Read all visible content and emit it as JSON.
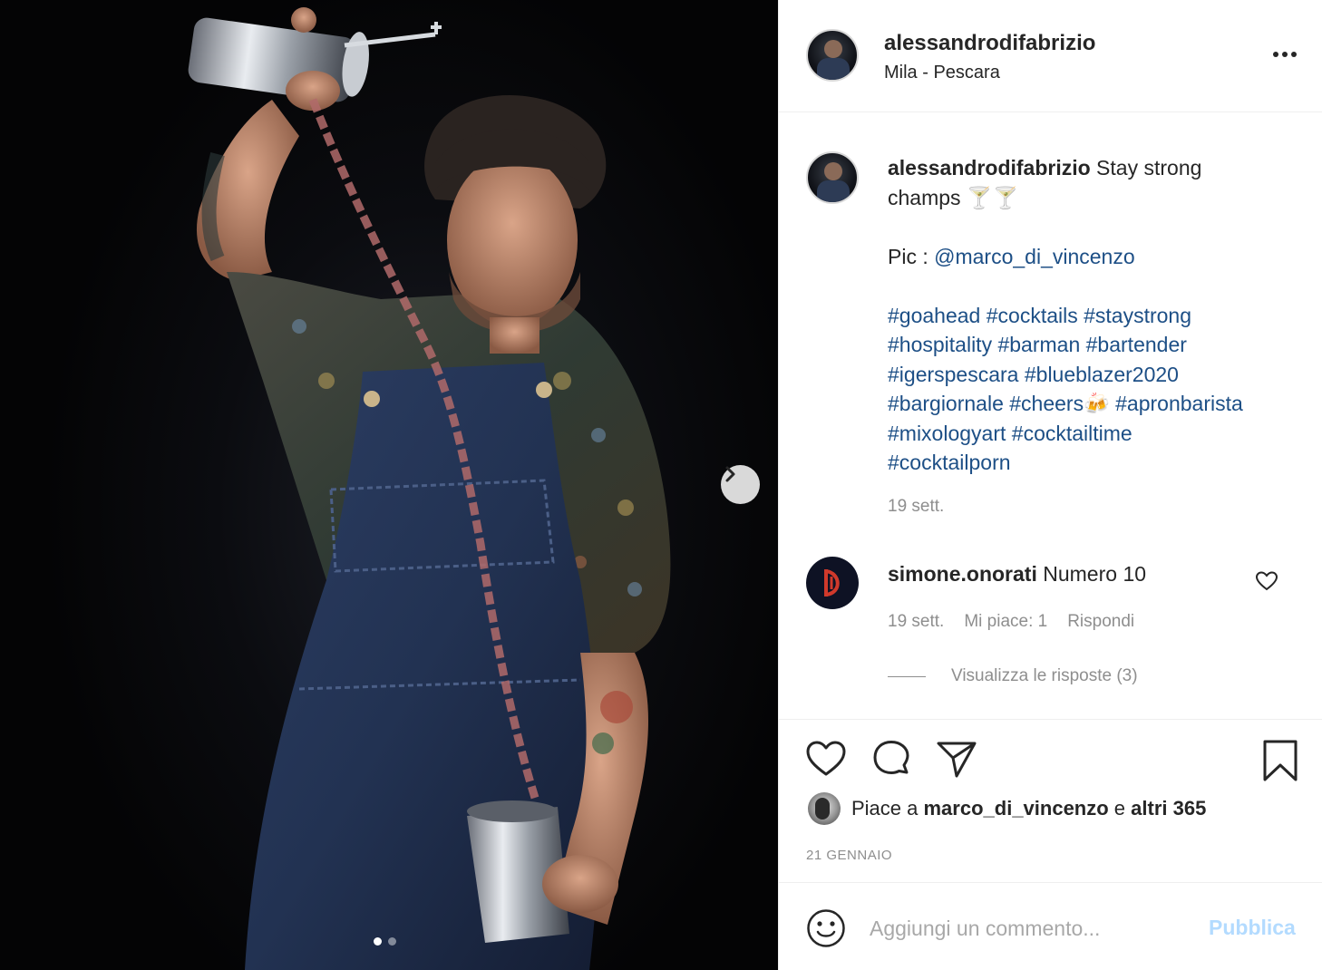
{
  "post": {
    "username": "alessandrodifabrizio",
    "location": "Mila - Pescara"
  },
  "caption": {
    "username": "alessandrodifabrizio",
    "text_line1": " Stay strong",
    "text_line2": "champs 🍸🍸",
    "credit_label": "Pic : ",
    "credit_mention": "@marco_di_vincenzo",
    "hashtags_row1": [
      "#goahead",
      "#cocktails",
      "#staystrong"
    ],
    "hashtags_row2": [
      "#hospitality",
      "#barman",
      "#bartender"
    ],
    "hashtags_row3": [
      "#igerspescara",
      "#blueblazer2020"
    ],
    "hashtags_row4a": "#bargiornale",
    "hashtags_row4b": "#cheers",
    "hashtags_row4_emoji": "🍻",
    "hashtags_row4c": "#apronbarista",
    "hashtags_row5": [
      "#mixologyart",
      "#cocktailtime"
    ],
    "hashtags_row6": [
      "#cocktailporn"
    ],
    "time": "19 sett."
  },
  "comment": {
    "username": "simone.onorati",
    "text": " Numero 10",
    "time": "19 sett.",
    "likes": "Mi piace: 1",
    "reply": "Rispondi",
    "view_replies": "Visualizza le risposte (3)"
  },
  "likes": {
    "prefix": "Piace a ",
    "user": "marco_di_vincenzo",
    "connector": " e ",
    "others": "altri 365"
  },
  "post_date": "21 GENNAIO",
  "add_comment": {
    "placeholder": "Aggiungi un commento...",
    "publish": "Pubblica"
  },
  "carousel": {
    "slides": 2,
    "current": 1
  },
  "colors": {
    "link": "#1d4f86",
    "muted": "#8e8e8e",
    "publish_disabled": "#b3dbff"
  },
  "icons": [
    "more-options-icon",
    "chevron-right-icon",
    "heart-icon",
    "comment-icon",
    "share-icon",
    "bookmark-icon",
    "emoji-icon"
  ]
}
